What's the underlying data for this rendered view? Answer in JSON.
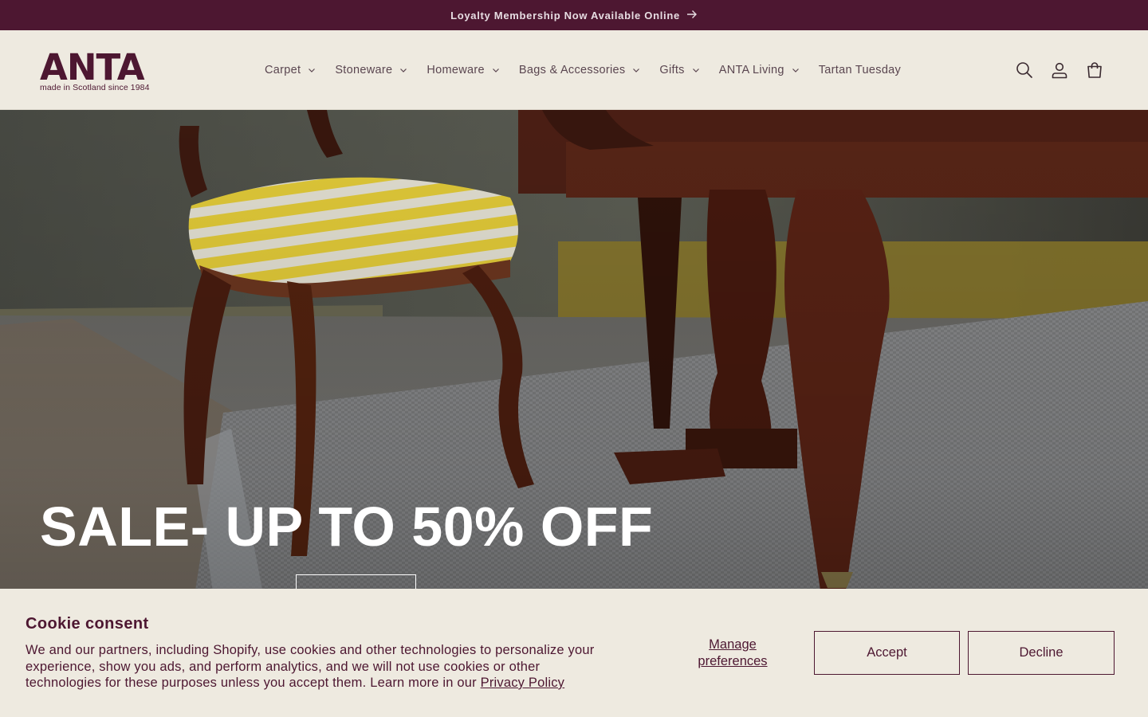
{
  "announcement": {
    "text": "Loyalty Membership Now Available Online",
    "arrow_icon": "arrow-right-icon"
  },
  "brand": {
    "name": "ANTA",
    "tagline": "made in Scotland since 1984"
  },
  "nav": {
    "items": [
      {
        "label": "Carpet",
        "has_dropdown": true
      },
      {
        "label": "Stoneware",
        "has_dropdown": true
      },
      {
        "label": "Homeware",
        "has_dropdown": true
      },
      {
        "label": "Bags & Accessories",
        "has_dropdown": true
      },
      {
        "label": "Gifts",
        "has_dropdown": true
      },
      {
        "label": "ANTA Living",
        "has_dropdown": true
      },
      {
        "label": "Tartan Tuesday",
        "has_dropdown": false
      }
    ]
  },
  "header_icons": [
    "search-icon",
    "account-icon",
    "cart-icon"
  ],
  "hero": {
    "title": "SALE- UP TO 50% OFF"
  },
  "cookie": {
    "title": "Cookie consent",
    "body": "We and our partners, including Shopify, use cookies and other technologies to personalize your experience, show you ads, and perform analytics, and we will not use cookies or other technologies for these purposes unless you accept them. Learn more in our ",
    "link": "Privacy Policy",
    "manage": "Manage preferences",
    "accept": "Accept",
    "decline": "Decline"
  },
  "colors": {
    "brand": "#4d1731",
    "background": "#eeeae0",
    "hero_text": "#ffffff"
  }
}
